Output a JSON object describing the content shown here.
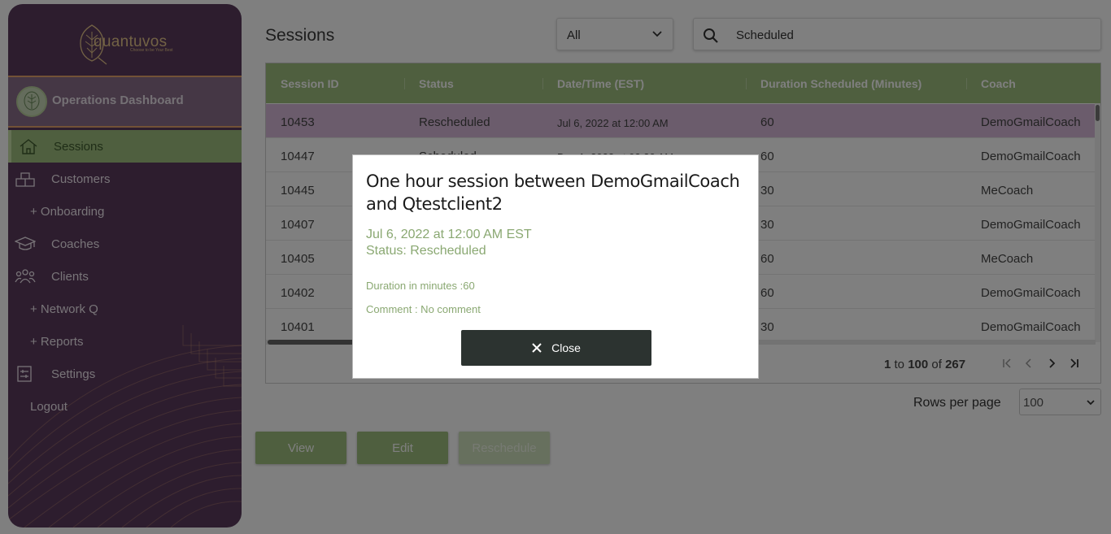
{
  "brand": {
    "name": "quantuvos",
    "tagline": "Choose to be Your Best"
  },
  "sidebar": {
    "header": "Operations Dashboard",
    "items": [
      {
        "label": "Sessions",
        "icon": "home-icon",
        "active": true
      },
      {
        "label": "Customers",
        "icon": "boxes-icon"
      },
      {
        "label": "+ Onboarding",
        "sub": true
      },
      {
        "label": "Coaches",
        "icon": "graduation-cap-icon"
      },
      {
        "label": "Clients",
        "icon": "users-icon"
      },
      {
        "label": "+ Network Q",
        "sub": true
      },
      {
        "label": "+ Reports",
        "sub": true
      },
      {
        "label": "Settings",
        "icon": "settings-sliders-icon"
      },
      {
        "label": "Logout",
        "sub": true
      }
    ]
  },
  "main": {
    "title": "Sessions",
    "filter": {
      "value": "All"
    },
    "search": {
      "value": "Scheduled"
    },
    "table": {
      "columns": [
        "Session ID",
        "Status",
        "Date/Time (EST)",
        "Duration Scheduled (Minutes)",
        "Coach"
      ],
      "rows": [
        {
          "id": "10453",
          "status": "Rescheduled",
          "datetime": "Jul 6, 2022 at 12:00 AM",
          "duration": "60",
          "coach": "DemoGmailCoach",
          "selected": true
        },
        {
          "id": "10447",
          "status": "Scheduled",
          "datetime": "Dec 1, 2022 at 02:30 AM",
          "duration": "60",
          "coach": "DemoGmailCoach"
        },
        {
          "id": "10445",
          "status": "",
          "datetime": "",
          "duration": "30",
          "coach": "MeCoach"
        },
        {
          "id": "10407",
          "status": "",
          "datetime": "",
          "duration": "30",
          "coach": "DemoGmailCoach"
        },
        {
          "id": "10405",
          "status": "",
          "datetime": "",
          "duration": "60",
          "coach": "MeCoach"
        },
        {
          "id": "10402",
          "status": "",
          "datetime": "",
          "duration": "60",
          "coach": "DemoGmailCoach"
        },
        {
          "id": "10401",
          "status": "",
          "datetime": "",
          "duration": "30",
          "coach": "DemoGmailCoach"
        }
      ]
    },
    "pagination": {
      "from": "1",
      "to_word": "to",
      "to": "100",
      "of_word": "of",
      "total": "267"
    },
    "rows_per_page": {
      "label": "Rows per page",
      "value": "100"
    },
    "actions": {
      "view": "View",
      "edit": "Edit",
      "reschedule": "Reschedule"
    }
  },
  "modal": {
    "title": "One hour session between DemoGmailCoach and Qtestclient2",
    "datetime": "Jul 6, 2022 at 12:00 AM EST",
    "status": "Status: Rescheduled",
    "duration": "Duration in minutes :60",
    "comment": "Comment : No comment",
    "close_label": "Close"
  },
  "colors": {
    "sidebar": "#5a3a5c",
    "accent": "#9fbf7e",
    "gold": "#e4c48a",
    "modal_button": "#2c3330"
  }
}
